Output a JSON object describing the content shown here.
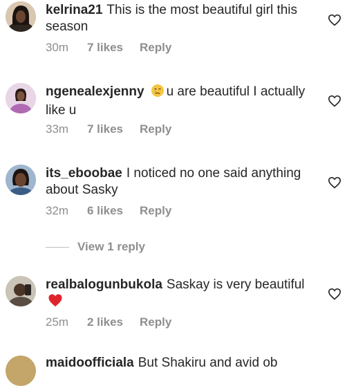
{
  "comments": [
    {
      "username": "kelrina21",
      "text": "This is the most beautiful girl this season",
      "time": "30m",
      "likes": "7 likes",
      "reply": "Reply",
      "emoji": ""
    },
    {
      "username": "ngenealexjenny",
      "text": "u are beautiful I actually like u",
      "time": "33m",
      "likes": "7 likes",
      "reply": "Reply",
      "emoji": "crying-face"
    },
    {
      "username": "its_eboobae",
      "text": "I noticed no one said anything about Sasky",
      "time": "32m",
      "likes": "6 likes",
      "reply": "Reply",
      "emoji": ""
    },
    {
      "username": "realbalogunbukola",
      "text": "Saskay is very beautiful",
      "time": "25m",
      "likes": "2 likes",
      "reply": "Reply",
      "emoji": "red-heart"
    },
    {
      "username": "maidoofficiala",
      "text": "But Shakiru and avid ob",
      "time": "",
      "likes": "",
      "reply": "",
      "emoji": ""
    }
  ],
  "view_replies": "View 1 reply",
  "colors": {
    "text": "#262626",
    "muted": "#8e8e8e",
    "heart_emoji": "#e0242b"
  },
  "icons": {
    "like": "heart-outline-icon"
  }
}
